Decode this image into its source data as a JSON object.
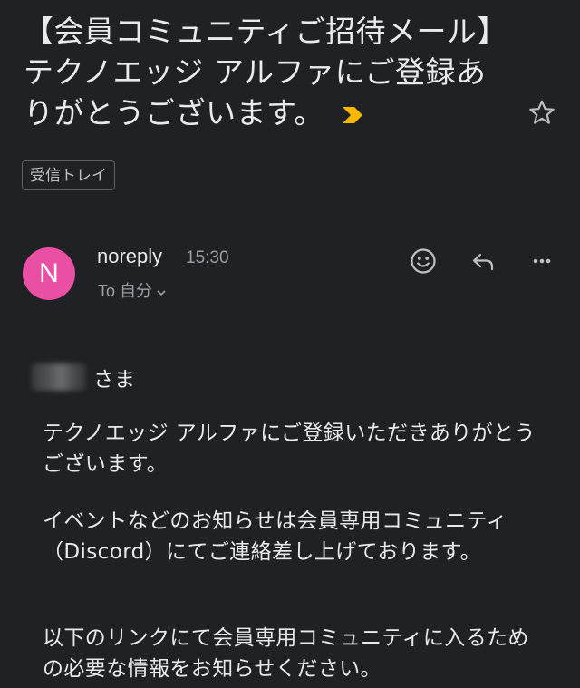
{
  "email": {
    "subject": "【会員コミュニティご招待メール】テクノエッジ アルファにご登録ありがとうございます。",
    "label": "受信トレイ",
    "sender": {
      "avatar_letter": "N",
      "avatar_color": "#e94fa2",
      "name": "noreply",
      "time": "15:30",
      "recipient": "To 自分"
    },
    "body": {
      "greeting_suffix": "さま",
      "paragraph_1": "テクノエッジ アルファにご登録いただきありがとうございます。",
      "paragraph_2": "イベントなどのお知らせは会員専用コミュニティ（Discord）にてご連絡差し上げております。",
      "paragraph_3": "以下のリンクにて会員専用コミュニティに入るための必要な情報をお知らせください。"
    }
  },
  "icons": {
    "importance": "importance-marker-icon",
    "star": "star-icon",
    "emoji": "emoji-reaction-icon",
    "reply": "reply-icon",
    "more": "more-options-icon",
    "recipient_expand": "chevron-down-icon"
  },
  "colors": {
    "background": "#202124",
    "importance": "#f9b800",
    "text": "#e8eaed",
    "muted_text": "#9aa0a6"
  }
}
